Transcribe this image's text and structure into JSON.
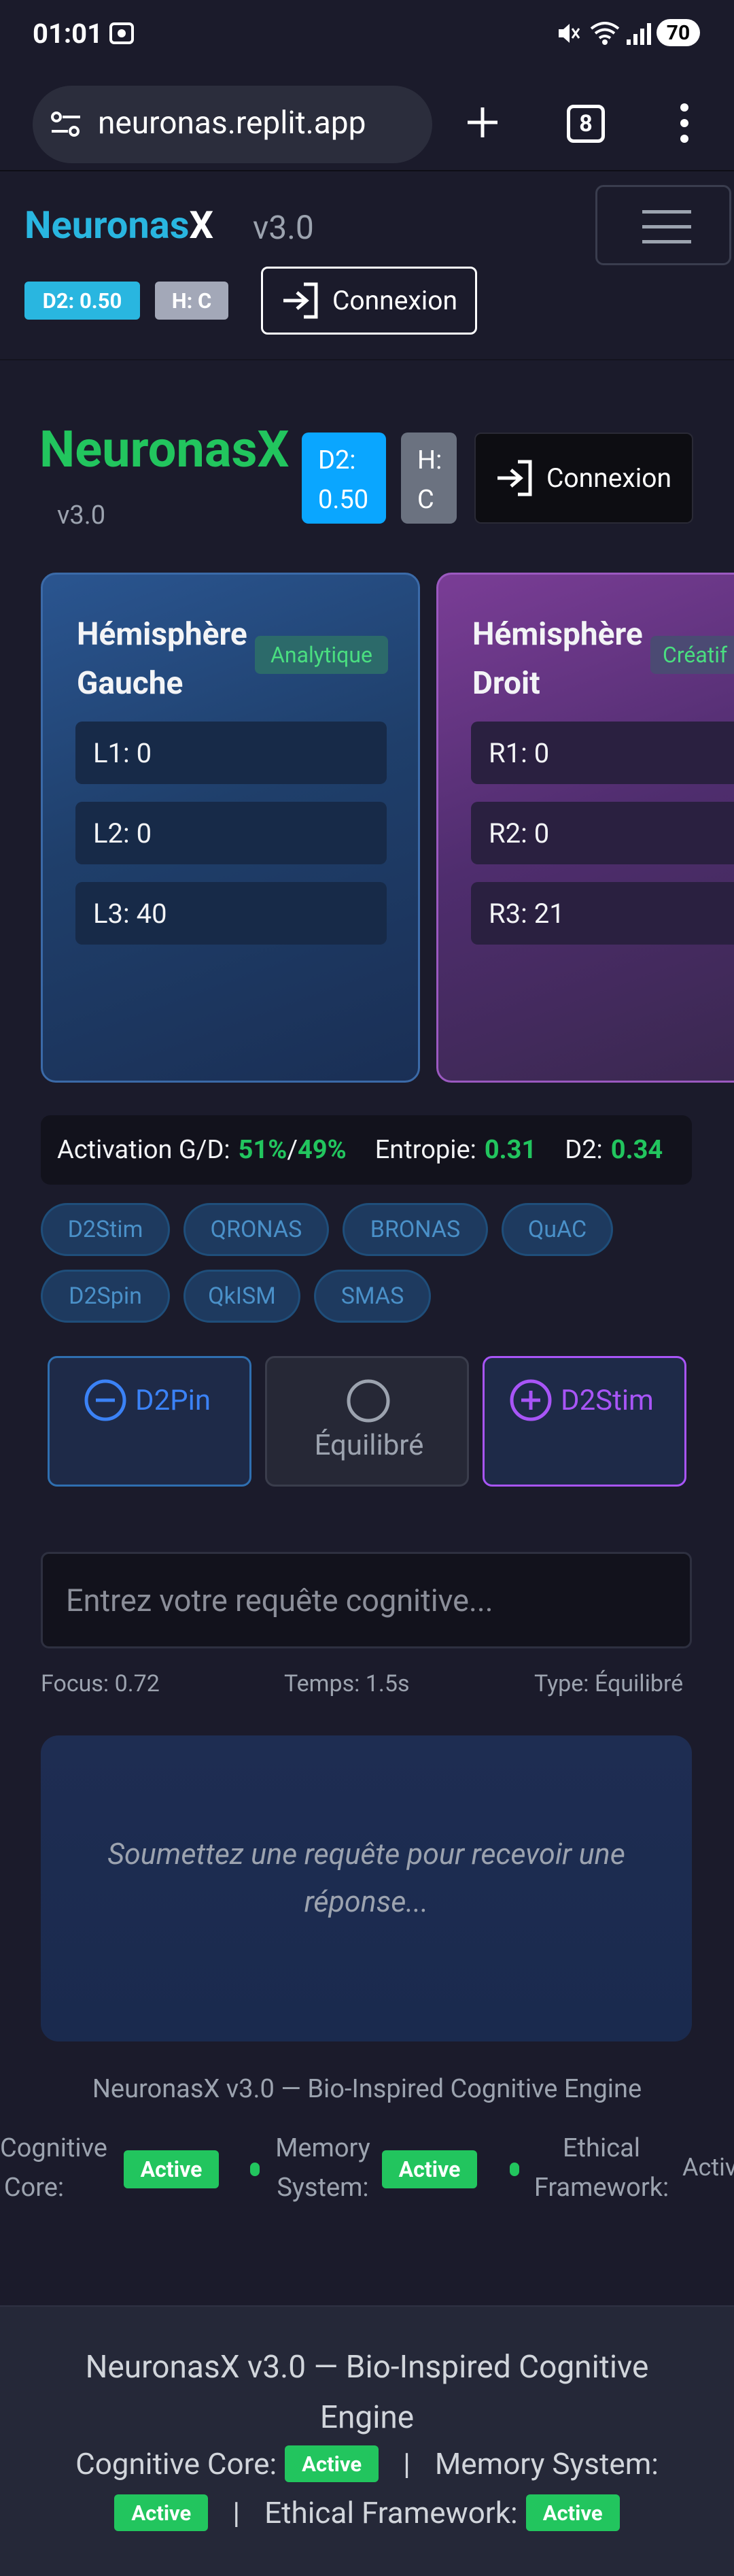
{
  "status_bar": {
    "time": "01:01",
    "battery": "70"
  },
  "browser": {
    "url": "neuronas.replit.app",
    "tab_count": "8"
  },
  "site_header": {
    "brand_main": "Neuronas",
    "brand_suffix": "X",
    "version": "v3.0",
    "d2_badge": "D2: 0.50",
    "h_badge": "H: C",
    "login_label": "Connexion"
  },
  "app_header": {
    "brand": "NeuronasX",
    "version": "v3.0",
    "d2_line1": "D2:",
    "d2_line2": "0.50",
    "h_line1": "H:",
    "h_line2": "C",
    "login_label": "Connexion"
  },
  "hemispheres": {
    "left": {
      "title_line1": "Hémisphère",
      "title_line2": "Gauche",
      "tag": "Analytique",
      "rows": [
        "L1: 0",
        "L2: 0",
        "L3: 40"
      ]
    },
    "right": {
      "title_line1": "Hémisphère",
      "title_line2": "Droit",
      "tag": "Créatif",
      "rows": [
        "R1: 0",
        "R2: 0",
        "R3: 21"
      ]
    }
  },
  "metrics": {
    "activation_label": "Activation G/D:",
    "activation_left": "51%",
    "slash": "/",
    "activation_right": "49%",
    "entropy_label": "Entropie:",
    "entropy_value": "0.31",
    "d2_label": "D2:",
    "d2_value": "0.34"
  },
  "chips": [
    "D2Stim",
    "QRONAS",
    "BRONAS",
    "QuAC",
    "D2Spin",
    "QkISM",
    "SMAS"
  ],
  "modes": {
    "d2pin": "D2Pin",
    "equilibre": "Équilibré",
    "d2stim": "D2Stim"
  },
  "query": {
    "placeholder": "Entrez votre requête cognitive...",
    "focus": "Focus: 0.72",
    "time": "Temps: 1.5s",
    "type": "Type: Équilibré"
  },
  "response": {
    "placeholder_line1": "Soumettez une requête pour recevoir une",
    "placeholder_line2": "réponse..."
  },
  "footer1": {
    "title": "NeuronasX v3.0 — Bio-Inspired Cognitive Engine",
    "cog_line1": "Cognitive",
    "cog_line2": "Core:",
    "mem_line1": "Memory",
    "mem_line2": "System:",
    "eth_line1": "Ethical",
    "eth_line2": "Framework:",
    "active": "Active",
    "active_cut": "Activ"
  },
  "footer2": {
    "title_line1": "NeuronasX v3.0 — Bio-Inspired Cognitive",
    "title_line2": "Engine",
    "cog": "Cognitive Core:",
    "mem": "Memory System:",
    "eth": "Ethical Framework:",
    "sep": "|",
    "active": "Active"
  },
  "colors": {
    "cyan": "#29b6e0",
    "green": "#22c55e",
    "purple": "#a855f7",
    "blue_btn": "#0aa6ff"
  }
}
